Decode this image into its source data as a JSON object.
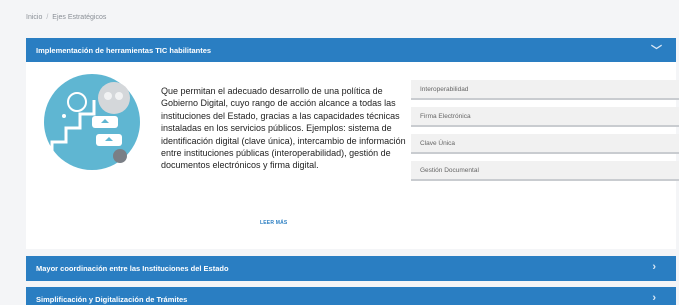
{
  "breadcrumb": {
    "home": "Inicio",
    "separator": "/",
    "current": "Ejes Estratégicos"
  },
  "panel": {
    "title": "Implementación de herramientas TIC habilitantes",
    "expanded_icon": "chevron-down-icon",
    "description": "Que permitan el adecuado desarrollo de una política de Gobierno Digital, cuyo rango de acción alcance a todas las instituciones del Estado, gracias a las capacidades técnicas instaladas en los servicios públicos. Ejemplos: sistema de identificación digital (clave única), intercambio de información entre instituciones públicas (interoperabilidad), gestión de documentos electrónicos y firma digital.",
    "read_more": "LEER MÁS",
    "chips": [
      "Interoperabilidad",
      "Firma Electrónica",
      "Clave Única",
      "Gestión Documental"
    ]
  },
  "accordion": [
    {
      "label": "Mayor coordinación entre las Instituciones del Estado",
      "icon": "chevron-right-icon"
    },
    {
      "label": "Simplificación y Digitalización de Trámites",
      "icon": "chevron-right-icon"
    }
  ],
  "colors": {
    "accent": "#2a7ec2",
    "illustration": "#5fb6d2"
  }
}
